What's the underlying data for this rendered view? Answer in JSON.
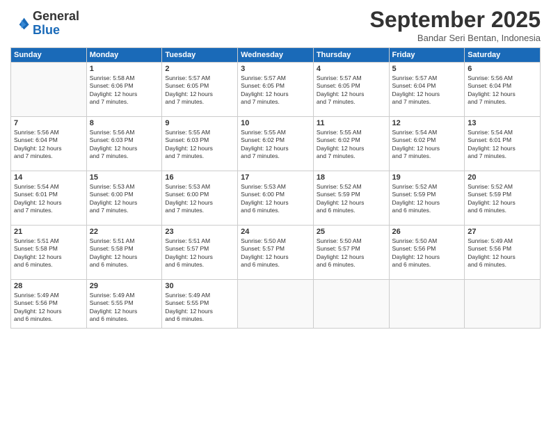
{
  "header": {
    "logo_general": "General",
    "logo_blue": "Blue",
    "month_title": "September 2025",
    "location": "Bandar Seri Bentan, Indonesia"
  },
  "days_of_week": [
    "Sunday",
    "Monday",
    "Tuesday",
    "Wednesday",
    "Thursday",
    "Friday",
    "Saturday"
  ],
  "weeks": [
    [
      {
        "day": "",
        "empty": true
      },
      {
        "day": "1",
        "sunrise": "5:58 AM",
        "sunset": "6:06 PM",
        "daylight": "12 hours and 7 minutes."
      },
      {
        "day": "2",
        "sunrise": "5:57 AM",
        "sunset": "6:05 PM",
        "daylight": "12 hours and 7 minutes."
      },
      {
        "day": "3",
        "sunrise": "5:57 AM",
        "sunset": "6:05 PM",
        "daylight": "12 hours and 7 minutes."
      },
      {
        "day": "4",
        "sunrise": "5:57 AM",
        "sunset": "6:05 PM",
        "daylight": "12 hours and 7 minutes."
      },
      {
        "day": "5",
        "sunrise": "5:57 AM",
        "sunset": "6:04 PM",
        "daylight": "12 hours and 7 minutes."
      },
      {
        "day": "6",
        "sunrise": "5:56 AM",
        "sunset": "6:04 PM",
        "daylight": "12 hours and 7 minutes."
      }
    ],
    [
      {
        "day": "7",
        "sunrise": "5:56 AM",
        "sunset": "6:04 PM",
        "daylight": "12 hours and 7 minutes."
      },
      {
        "day": "8",
        "sunrise": "5:56 AM",
        "sunset": "6:03 PM",
        "daylight": "12 hours and 7 minutes."
      },
      {
        "day": "9",
        "sunrise": "5:55 AM",
        "sunset": "6:03 PM",
        "daylight": "12 hours and 7 minutes."
      },
      {
        "day": "10",
        "sunrise": "5:55 AM",
        "sunset": "6:02 PM",
        "daylight": "12 hours and 7 minutes."
      },
      {
        "day": "11",
        "sunrise": "5:55 AM",
        "sunset": "6:02 PM",
        "daylight": "12 hours and 7 minutes."
      },
      {
        "day": "12",
        "sunrise": "5:54 AM",
        "sunset": "6:02 PM",
        "daylight": "12 hours and 7 minutes."
      },
      {
        "day": "13",
        "sunrise": "5:54 AM",
        "sunset": "6:01 PM",
        "daylight": "12 hours and 7 minutes."
      }
    ],
    [
      {
        "day": "14",
        "sunrise": "5:54 AM",
        "sunset": "6:01 PM",
        "daylight": "12 hours and 7 minutes."
      },
      {
        "day": "15",
        "sunrise": "5:53 AM",
        "sunset": "6:00 PM",
        "daylight": "12 hours and 7 minutes."
      },
      {
        "day": "16",
        "sunrise": "5:53 AM",
        "sunset": "6:00 PM",
        "daylight": "12 hours and 7 minutes."
      },
      {
        "day": "17",
        "sunrise": "5:53 AM",
        "sunset": "6:00 PM",
        "daylight": "12 hours and 6 minutes."
      },
      {
        "day": "18",
        "sunrise": "5:52 AM",
        "sunset": "5:59 PM",
        "daylight": "12 hours and 6 minutes."
      },
      {
        "day": "19",
        "sunrise": "5:52 AM",
        "sunset": "5:59 PM",
        "daylight": "12 hours and 6 minutes."
      },
      {
        "day": "20",
        "sunrise": "5:52 AM",
        "sunset": "5:59 PM",
        "daylight": "12 hours and 6 minutes."
      }
    ],
    [
      {
        "day": "21",
        "sunrise": "5:51 AM",
        "sunset": "5:58 PM",
        "daylight": "12 hours and 6 minutes."
      },
      {
        "day": "22",
        "sunrise": "5:51 AM",
        "sunset": "5:58 PM",
        "daylight": "12 hours and 6 minutes."
      },
      {
        "day": "23",
        "sunrise": "5:51 AM",
        "sunset": "5:57 PM",
        "daylight": "12 hours and 6 minutes."
      },
      {
        "day": "24",
        "sunrise": "5:50 AM",
        "sunset": "5:57 PM",
        "daylight": "12 hours and 6 minutes."
      },
      {
        "day": "25",
        "sunrise": "5:50 AM",
        "sunset": "5:57 PM",
        "daylight": "12 hours and 6 minutes."
      },
      {
        "day": "26",
        "sunrise": "5:50 AM",
        "sunset": "5:56 PM",
        "daylight": "12 hours and 6 minutes."
      },
      {
        "day": "27",
        "sunrise": "5:49 AM",
        "sunset": "5:56 PM",
        "daylight": "12 hours and 6 minutes."
      }
    ],
    [
      {
        "day": "28",
        "sunrise": "5:49 AM",
        "sunset": "5:56 PM",
        "daylight": "12 hours and 6 minutes."
      },
      {
        "day": "29",
        "sunrise": "5:49 AM",
        "sunset": "5:55 PM",
        "daylight": "12 hours and 6 minutes."
      },
      {
        "day": "30",
        "sunrise": "5:49 AM",
        "sunset": "5:55 PM",
        "daylight": "12 hours and 6 minutes."
      },
      {
        "day": "",
        "empty": true
      },
      {
        "day": "",
        "empty": true
      },
      {
        "day": "",
        "empty": true
      },
      {
        "day": "",
        "empty": true
      }
    ]
  ]
}
